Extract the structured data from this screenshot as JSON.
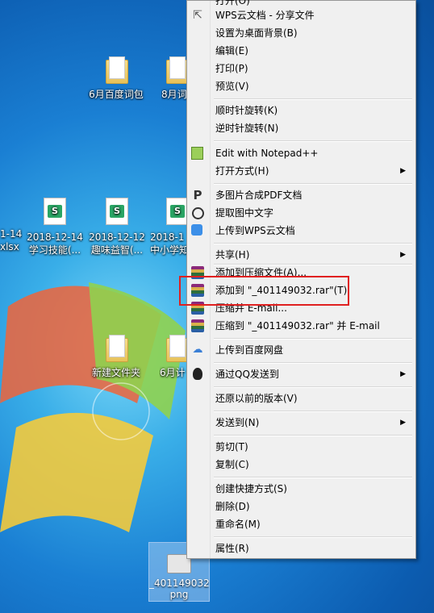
{
  "desktop": {
    "icons": [
      {
        "label": "6月百度词包",
        "type": "folder"
      },
      {
        "label": "8月词",
        "type": "folder"
      },
      {
        "label": "1-14",
        "type": "excel"
      },
      {
        "label": "xlsx",
        "type": "excel"
      },
      {
        "label": "2018-12-14",
        "type": "excel"
      },
      {
        "label": "学习技能(...",
        "type": "excel"
      },
      {
        "label": "2018-12-12",
        "type": "excel"
      },
      {
        "label": "趣味益智(...",
        "type": "excel"
      },
      {
        "label": "2018-1",
        "type": "excel"
      },
      {
        "label": "中小学知",
        "type": "excel"
      },
      {
        "label": "新建文件夹",
        "type": "folder"
      },
      {
        "label": "6月计",
        "type": "folder"
      }
    ],
    "selected_file": {
      "name": "_401149032.",
      "ext": "png"
    }
  },
  "menu": {
    "items": [
      {
        "label": "打开(O)",
        "icon": ""
      },
      {
        "label": "WPS云文档 - 分享文件",
        "icon": "share-icon"
      },
      {
        "label": "设置为桌面背景(B)",
        "icon": ""
      },
      {
        "label": "编辑(E)",
        "icon": ""
      },
      {
        "label": "打印(P)",
        "icon": ""
      },
      {
        "label": "预览(V)",
        "icon": ""
      },
      {
        "label": "顺时针旋转(K)",
        "icon": ""
      },
      {
        "label": "逆时针旋转(N)",
        "icon": ""
      },
      {
        "label": "Edit with Notepad++",
        "icon": "notepad-icon"
      },
      {
        "label": "打开方式(H)",
        "icon": ""
      },
      {
        "label": "多图片合成PDF文档",
        "icon": "pdf-icon"
      },
      {
        "label": "提取图中文字",
        "icon": "ocr-icon"
      },
      {
        "label": "上传到WPS云文档",
        "icon": "cloud-box-icon"
      },
      {
        "label": "共享(H)",
        "icon": ""
      },
      {
        "label": "添加到压缩文件(A)...",
        "icon": "winrar-icon"
      },
      {
        "label": "添加到 \"_401149032.rar\"(T)",
        "icon": "winrar-icon"
      },
      {
        "label": "压缩并 E-mail...",
        "icon": "winrar-icon"
      },
      {
        "label": "压缩到 \"_401149032.rar\" 并 E-mail",
        "icon": "winrar-icon"
      },
      {
        "label": "上传到百度网盘",
        "icon": "baidu-cloud-icon"
      },
      {
        "label": "通过QQ发送到",
        "icon": "qq-icon"
      },
      {
        "label": "还原以前的版本(V)",
        "icon": ""
      },
      {
        "label": "发送到(N)",
        "icon": ""
      },
      {
        "label": "剪切(T)",
        "icon": ""
      },
      {
        "label": "复制(C)",
        "icon": ""
      },
      {
        "label": "创建快捷方式(S)",
        "icon": ""
      },
      {
        "label": "删除(D)",
        "icon": ""
      },
      {
        "label": "重命名(M)",
        "icon": ""
      },
      {
        "label": "属性(R)",
        "icon": ""
      }
    ],
    "submenu_arrow": "▶"
  },
  "colors": {
    "highlight_border": "#e02020",
    "menu_bg": "#f0f0f0"
  }
}
